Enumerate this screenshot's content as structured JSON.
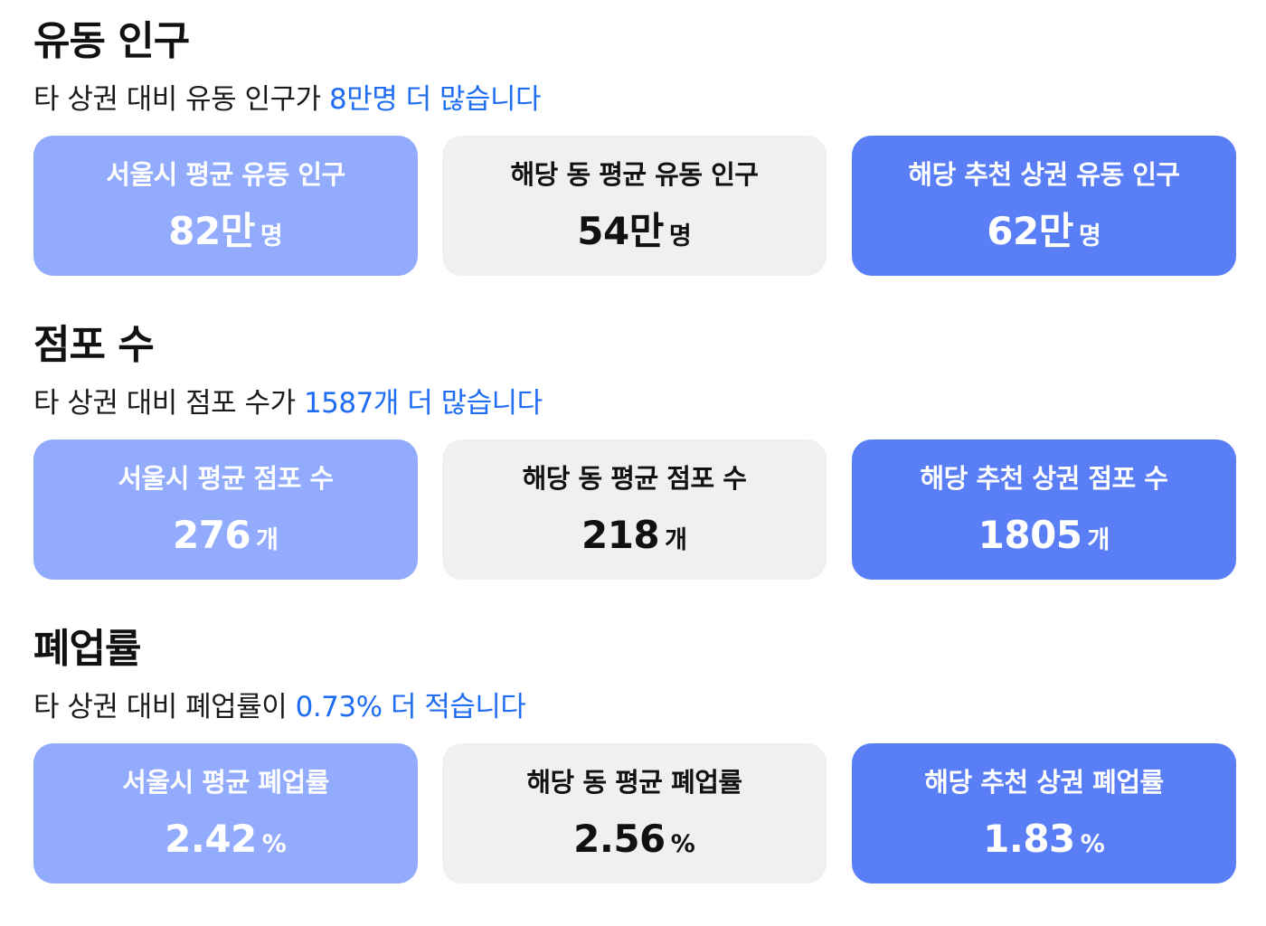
{
  "colors": {
    "highlight": "#1f6df2",
    "card_seoul_bg": "#92abfc",
    "card_dong_bg": "#f0f0f0",
    "card_area_bg": "#5a7ef5"
  },
  "sections": [
    {
      "title": "유동 인구",
      "desc_prefix": "타 상권 대비 유동 인구가 ",
      "desc_highlight": "8만명 더 많습니다",
      "cards": [
        {
          "label": "서울시 평균 유동 인구",
          "value": "82만",
          "unit": "명"
        },
        {
          "label": "해당 동 평균 유동 인구",
          "value": "54만",
          "unit": "명"
        },
        {
          "label": "해당 추천 상권 유동 인구",
          "value": "62만",
          "unit": "명"
        }
      ]
    },
    {
      "title": "점포 수",
      "desc_prefix": "타 상권 대비 점포 수가 ",
      "desc_highlight": "1587개 더 많습니다",
      "cards": [
        {
          "label": "서울시 평균 점포 수",
          "value": "276",
          "unit": "개"
        },
        {
          "label": "해당 동 평균 점포 수",
          "value": "218",
          "unit": "개"
        },
        {
          "label": "해당 추천 상권 점포 수",
          "value": "1805",
          "unit": "개"
        }
      ]
    },
    {
      "title": "폐업률",
      "desc_prefix": "타 상권 대비 폐업률이 ",
      "desc_highlight": "0.73% 더 적습니다",
      "cards": [
        {
          "label": "서울시 평균 폐업률",
          "value": "2.42",
          "unit": "%"
        },
        {
          "label": "해당 동 평균 폐업률",
          "value": "2.56",
          "unit": "%"
        },
        {
          "label": "해당 추천 상권 폐업률",
          "value": "1.83",
          "unit": "%"
        }
      ]
    }
  ]
}
